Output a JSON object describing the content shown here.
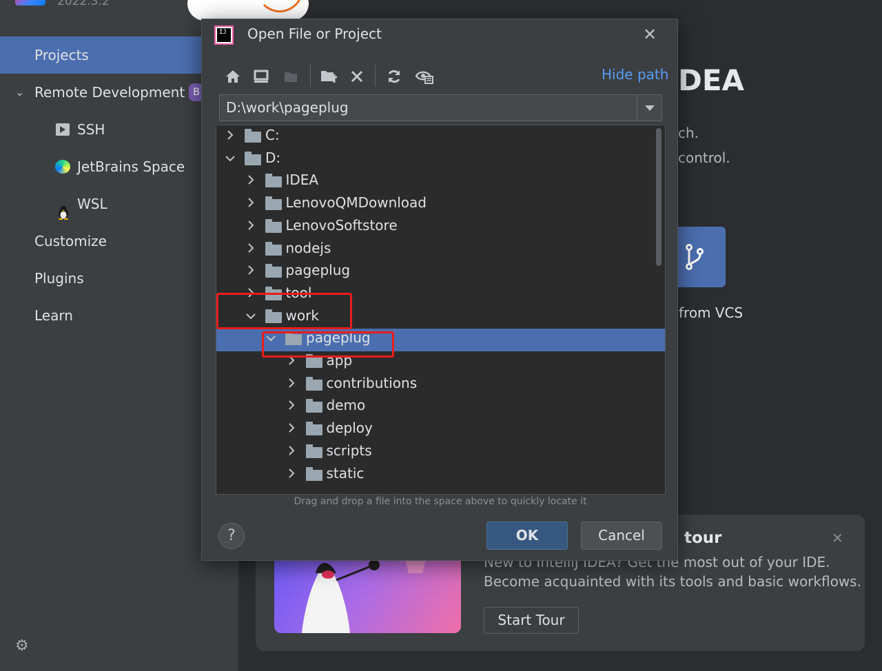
{
  "app": {
    "version": "2022.3.2"
  },
  "sidebar": {
    "items": [
      {
        "label": "Projects",
        "selected": true
      },
      {
        "label": "Remote Development",
        "badge": "B",
        "expanded": true
      },
      {
        "label": "SSH",
        "icon": "terminal-icon"
      },
      {
        "label": "JetBrains Space",
        "icon": "jetbrains-space-icon"
      },
      {
        "label": "WSL",
        "icon": "linux-penguin-icon"
      },
      {
        "label": "Customize"
      },
      {
        "label": "Plugins"
      },
      {
        "label": "Learn"
      }
    ],
    "settings_icon": "gear-icon"
  },
  "welcome": {
    "title_fragment": "DEA",
    "line1_fragment": "ch.",
    "line2_fragment": "control.",
    "vcs_label": "from VCS"
  },
  "tour": {
    "title_fragment": "tour",
    "text1": "New to IntelliJ IDEA? Get the most out of your IDE.",
    "text2": "Become acquainted with its tools and basic workflows.",
    "start_label": "Start Tour"
  },
  "dialog": {
    "title": "Open File or Project",
    "toolbar": {
      "icons": [
        "home-icon",
        "desktop-icon",
        "project-folder-icon",
        "new-folder-icon",
        "delete-icon",
        "refresh-icon",
        "show-hidden-icon"
      ],
      "hide_path_label": "Hide path"
    },
    "path": {
      "value": "D:\\work\\pageplug"
    },
    "tree": [
      {
        "name": "C:",
        "depth": 0,
        "expanded": false
      },
      {
        "name": "D:",
        "depth": 0,
        "expanded": true
      },
      {
        "name": "IDEA",
        "depth": 1,
        "expanded": false
      },
      {
        "name": "LenovoQMDownload",
        "depth": 1,
        "expanded": false
      },
      {
        "name": "LenovoSoftstore",
        "depth": 1,
        "expanded": false
      },
      {
        "name": "nodejs",
        "depth": 1,
        "expanded": false
      },
      {
        "name": "pageplug",
        "depth": 1,
        "expanded": false
      },
      {
        "name": "tool",
        "depth": 1,
        "expanded": false
      },
      {
        "name": "work",
        "depth": 1,
        "expanded": true
      },
      {
        "name": "pageplug",
        "depth": 2,
        "expanded": true,
        "selected": true
      },
      {
        "name": "app",
        "depth": 3,
        "expanded": false
      },
      {
        "name": "contributions",
        "depth": 3,
        "expanded": false
      },
      {
        "name": "demo",
        "depth": 3,
        "expanded": false
      },
      {
        "name": "deploy",
        "depth": 3,
        "expanded": false
      },
      {
        "name": "scripts",
        "depth": 3,
        "expanded": false
      },
      {
        "name": "static",
        "depth": 3,
        "expanded": false
      }
    ],
    "drop_hint": "Drag and drop a file into the space above to quickly locate it",
    "ok_label": "OK",
    "cancel_label": "Cancel",
    "help_label": "?"
  },
  "colors": {
    "accent": "#4b6eaf",
    "annotation": "#ea1c1c",
    "link": "#589df6"
  }
}
